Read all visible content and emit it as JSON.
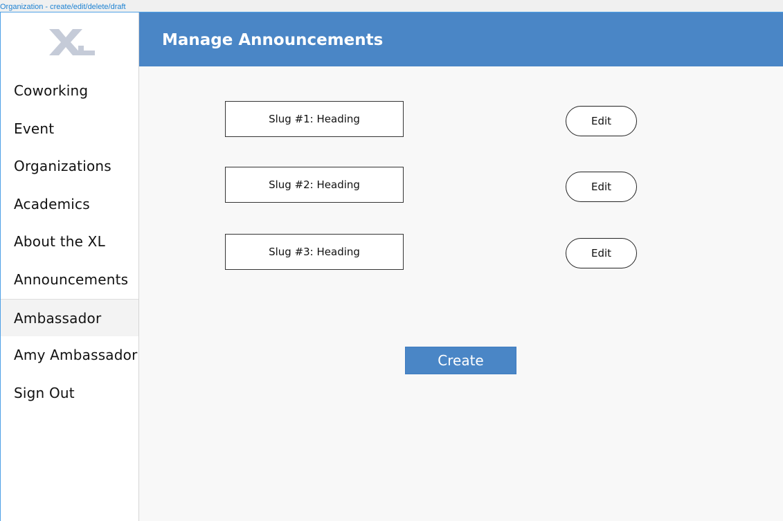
{
  "frame_label": "Organization - create/edit/delete/draft",
  "logo": {
    "text": "XL",
    "color": "#c5cbd8"
  },
  "sidebar": {
    "items": [
      {
        "label": "Coworking"
      },
      {
        "label": "Event"
      },
      {
        "label": "Organizations"
      },
      {
        "label": "Academics"
      },
      {
        "label": "About the XL"
      },
      {
        "label": "Announcements"
      },
      {
        "label": "Ambassador",
        "active": true
      },
      {
        "label": "Amy Ambassador"
      },
      {
        "label": "Sign Out"
      }
    ]
  },
  "header": {
    "title": "Manage Announcements",
    "color": "#4a86c6"
  },
  "announcements": [
    {
      "slug": "Slug #1: Heading",
      "edit_label": "Edit"
    },
    {
      "slug": "Slug #2: Heading",
      "edit_label": "Edit"
    },
    {
      "slug": "Slug #3: Heading",
      "edit_label": "Edit"
    }
  ],
  "create_label": "Create"
}
